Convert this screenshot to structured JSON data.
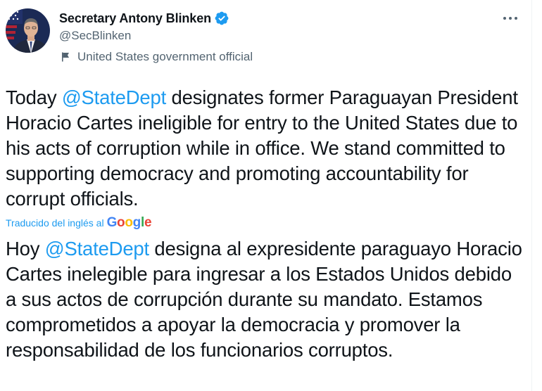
{
  "author": {
    "name": "Secretary Antony Blinken",
    "handle": "@SecBlinken",
    "label": "United States government official"
  },
  "icons": {
    "verified": "verified-badge-icon",
    "label": "flag-icon",
    "more": "more-dots-icon"
  },
  "colors": {
    "accent": "#1d9bf0",
    "text": "#0f1419",
    "secondary": "#536471"
  },
  "tweet": {
    "original": {
      "before_mention": "Today ",
      "mention": "@StateDept",
      "after_mention": " designates former Paraguayan President Horacio Cartes ineligible for entry to the United States due to his acts of corruption while in office. We stand committed to supporting democracy and promoting accountability for corrupt officials."
    },
    "translation_note": "Traducido del inglés al",
    "translation_provider": "Google",
    "translated": {
      "before_mention": "Hoy ",
      "mention": "@StateDept",
      "after_mention": " designa al expresidente paraguayo Horacio Cartes inelegible para ingresar a los Estados Unidos debido a sus actos de corrupción durante su mandato. Estamos comprometidos a apoyar la democracia y promover la responsabilidad de los funcionarios corruptos."
    }
  }
}
